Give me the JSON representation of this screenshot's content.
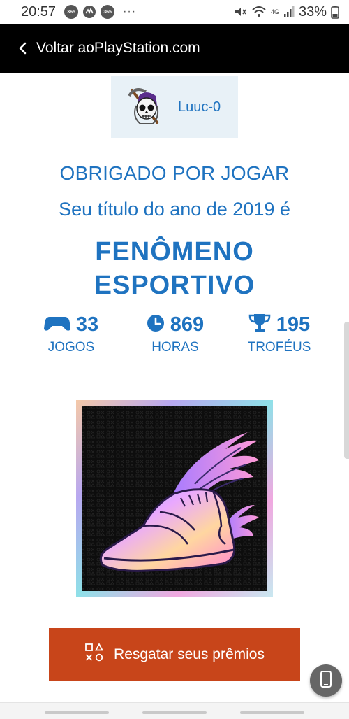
{
  "status_bar": {
    "time": "20:57",
    "badges": [
      "365",
      "365"
    ],
    "extra": "···",
    "network": "4G",
    "battery": "33%"
  },
  "nav": {
    "back_label": "Voltar aoPlayStation.com",
    "icon": "chevron-left-icon"
  },
  "profile": {
    "username": "Luuc-0",
    "avatar": "reaper-avatar"
  },
  "headline": {
    "thanks": "OBRIGADO POR JOGAR",
    "title_intro": "Seu título do ano de 2019 é",
    "award_line1": "FENÔMENO",
    "award_line2": "ESPORTIVO"
  },
  "stats": [
    {
      "value": "33",
      "label": "JOGOS",
      "icon": "gamepad-icon"
    },
    {
      "value": "869",
      "label": "HORAS",
      "icon": "clock-icon"
    },
    {
      "value": "195",
      "label": "TROFÉUS",
      "icon": "trophy-icon"
    }
  ],
  "award_art": "winged-sneaker",
  "cta": {
    "label": "Resgatar seus prêmios",
    "icon": "playstation-shapes-icon"
  },
  "colors": {
    "brand_blue": "#1f73c0",
    "cta_orange": "#c8451a",
    "nav_black": "#000000"
  }
}
